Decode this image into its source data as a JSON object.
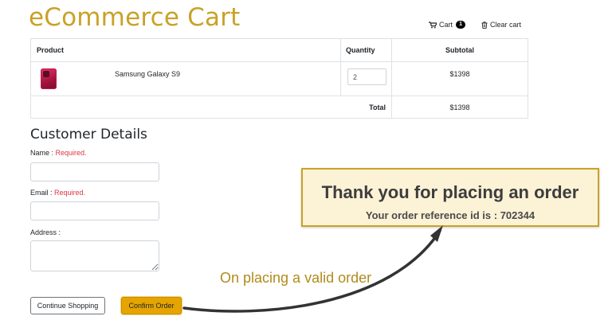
{
  "header": {
    "title": "eCommerce Cart",
    "cart_label": "Cart",
    "cart_count": "1",
    "clear_label": "Clear cart"
  },
  "table": {
    "headers": {
      "product": "Product",
      "quantity": "Quantity",
      "subtotal": "Subtotal"
    },
    "items": [
      {
        "name": "Samsung Galaxy S9",
        "quantity": "2",
        "subtotal": "$1398"
      }
    ],
    "total_label": "Total",
    "total_value": "$1398"
  },
  "customer": {
    "heading": "Customer Details",
    "name_label": "Name :",
    "email_label": "Email :",
    "address_label": "Address :",
    "required_text": "Required."
  },
  "buttons": {
    "continue": "Continue Shopping",
    "confirm": "Confirm Order"
  },
  "confirmation": {
    "title": "Thank you for placing an order",
    "reference": "Your order reference id is : 702344"
  },
  "annotation": "On placing a valid order",
  "colors": {
    "brand": "#c9a227",
    "confirm_button": "#e5a400",
    "required": "#dc3545",
    "box_bg": "#fcf2d6"
  },
  "icons": {
    "cart": "shopping-cart-icon",
    "clear": "trash-icon"
  }
}
